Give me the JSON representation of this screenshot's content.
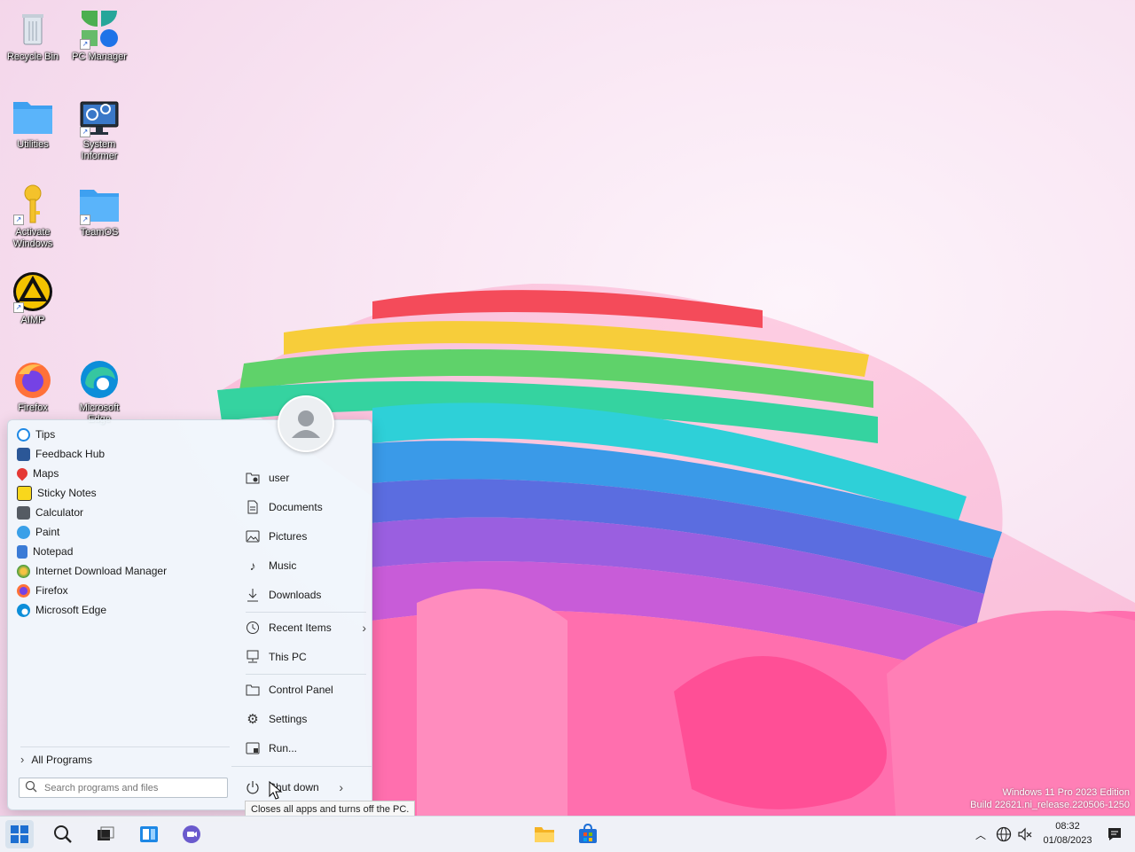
{
  "desktop": {
    "icons": [
      {
        "label": "Recycle Bin"
      },
      {
        "label": "PC Manager"
      },
      {
        "label": "Utilities"
      },
      {
        "label": "System Informer"
      },
      {
        "label": "Activate Windows"
      },
      {
        "label": "TeamOS"
      },
      {
        "label": "AIMP"
      },
      {
        "label": "Firefox"
      },
      {
        "label": "Microsoft Edge"
      }
    ],
    "watermark_line1": "Windows 11 Pro 2023 Edition",
    "watermark_line2": "Build 22621.ni_release.220506-1250"
  },
  "start_menu": {
    "apps": [
      {
        "label": "Tips",
        "icon": "tips-icon",
        "color": "#1e88e5"
      },
      {
        "label": "Feedback Hub",
        "icon": "feedback-hub-icon",
        "color": "#2b5797"
      },
      {
        "label": "Maps",
        "icon": "maps-icon",
        "color": "#e53935"
      },
      {
        "label": "Sticky Notes",
        "icon": "sticky-notes-icon",
        "color": "#f9d71c"
      },
      {
        "label": "Calculator",
        "icon": "calculator-icon",
        "color": "#555b63"
      },
      {
        "label": "Paint",
        "icon": "paint-icon",
        "color": "#3aa0e8"
      },
      {
        "label": "Notepad",
        "icon": "notepad-icon",
        "color": "#3b7bd6"
      },
      {
        "label": "Internet Download Manager",
        "icon": "idm-icon",
        "color": "#3d9a3d"
      },
      {
        "label": "Firefox",
        "icon": "firefox-icon",
        "color": "#ff7139"
      },
      {
        "label": "Microsoft Edge",
        "icon": "edge-icon",
        "color": "#0c8ed9"
      }
    ],
    "all_programs_label": "All Programs",
    "search_placeholder": "Search programs and files",
    "places": [
      {
        "label": "user",
        "icon": "user-folder-icon"
      },
      {
        "label": "Documents",
        "icon": "documents-icon"
      },
      {
        "label": "Pictures",
        "icon": "pictures-icon"
      },
      {
        "label": "Music",
        "icon": "music-icon"
      },
      {
        "label": "Downloads",
        "icon": "downloads-icon"
      },
      {
        "label": "Recent Items",
        "icon": "recent-items-icon"
      },
      {
        "label": "This PC",
        "icon": "this-pc-icon"
      },
      {
        "label": "Control Panel",
        "icon": "control-panel-icon"
      },
      {
        "label": "Settings",
        "icon": "settings-icon"
      },
      {
        "label": "Run...",
        "icon": "run-icon"
      }
    ],
    "shutdown_label": "Shut down",
    "shutdown_tooltip": "Closes all apps and turns off the PC."
  },
  "taskbar": {
    "time": "08:32",
    "date": "01/08/2023"
  }
}
